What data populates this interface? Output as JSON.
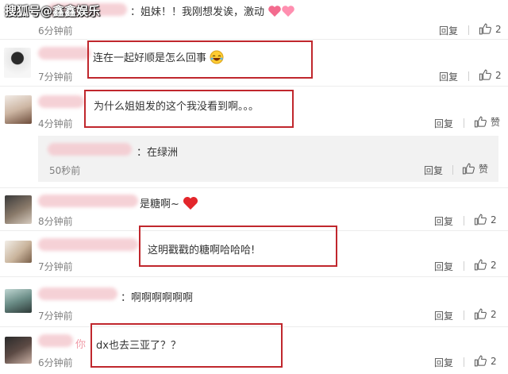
{
  "watermark": "搜狐号@鑫鑫娱乐",
  "comments": [
    {
      "id": "c1",
      "text": "：姐妹！！我刚想发诶，激动",
      "time": "6分钟前",
      "reply": "回复",
      "likes": "2"
    },
    {
      "id": "c2",
      "text": "连在一起好顺是怎么回事",
      "time": "7分钟前",
      "reply": "回复",
      "likes": "2"
    },
    {
      "id": "c3",
      "text": "为什么姐姐发的这个我没看到啊。。。",
      "time": "4分钟前",
      "reply": "回复",
      "likes": "赞"
    },
    {
      "id": "c3r",
      "text": "：在绿洲",
      "time": "50秒前",
      "reply": "回复",
      "likes": "赞"
    },
    {
      "id": "c4",
      "text": "是糖啊~",
      "time": "8分钟前",
      "reply": "回复",
      "likes": "2"
    },
    {
      "id": "c5",
      "text": "这明戳戳的糖啊哈哈哈!",
      "time": "7分钟前",
      "reply": "回复",
      "likes": "2"
    },
    {
      "id": "c6",
      "text": "：啊啊啊啊啊啊",
      "time": "7分钟前",
      "reply": "回复",
      "likes": "2"
    },
    {
      "id": "c7",
      "prefix": "你",
      "text": "dx也去三亚了？？",
      "time": "6分钟前",
      "reply": "回复",
      "likes": "2"
    }
  ],
  "colors": {
    "highlight_box": "#c0272d",
    "text": "#333333",
    "meta": "#808080"
  },
  "icons": {
    "like": "thumbs-up-icon",
    "heart": "heart-icon",
    "laugh": "laughing-emoji-icon"
  }
}
